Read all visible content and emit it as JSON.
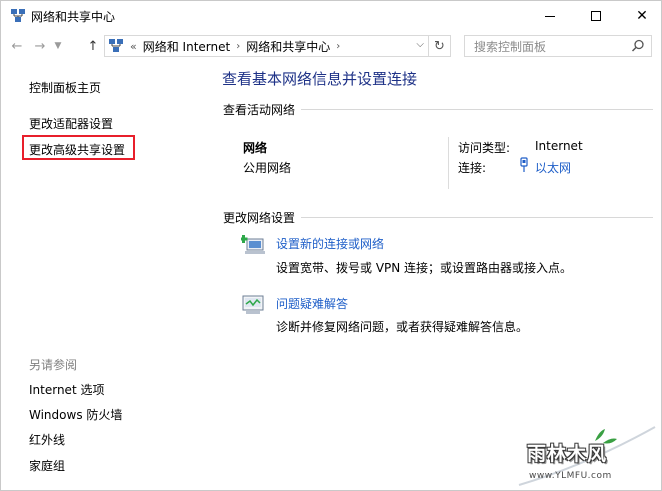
{
  "window": {
    "title": "网络和共享中心",
    "controls": {
      "minimize": "",
      "maximize": "",
      "close": "✕"
    }
  },
  "nav": {
    "breadcrumb_prefix": "«",
    "breadcrumb": [
      "网络和 Internet",
      "网络和共享中心"
    ],
    "breadcrumb_sep": "›",
    "search_placeholder": "搜索控制面板"
  },
  "sidebar": {
    "links": {
      "home": "控制面板主页",
      "adapter": "更改适配器设置",
      "advanced_sharing": "更改高级共享设置"
    },
    "see_also_title": "另请参阅",
    "see_also": {
      "internet_options": "Internet 选项",
      "firewall": "Windows 防火墙",
      "infrared": "红外线",
      "homegroup": "家庭组"
    },
    "highlight_color": "#e81f2b"
  },
  "main": {
    "title": "查看基本网络信息并设置连接",
    "active_networks_header": "查看活动网络",
    "network": {
      "name": "网络",
      "type": "公用网络",
      "access_type_label": "访问类型:",
      "access_type_value": "Internet",
      "connection_label": "连接:",
      "connection_value": "以太网"
    },
    "change_settings_header": "更改网络设置",
    "tasks": {
      "setup": {
        "link": "设置新的连接或网络",
        "desc": "设置宽带、拨号或 VPN 连接；或设置路由器或接入点。"
      },
      "troubleshoot": {
        "link": "问题疑难解答",
        "desc": "诊断并修复网络问题，或者获得疑难解答信息。"
      }
    }
  },
  "watermark": {
    "logo_text": "雨林木风",
    "url": "www.YLMFU.com"
  },
  "colors": {
    "title_blue": "#1e3287",
    "link_blue": "#1e5ec8",
    "muted_gray": "#7f7f7f"
  }
}
